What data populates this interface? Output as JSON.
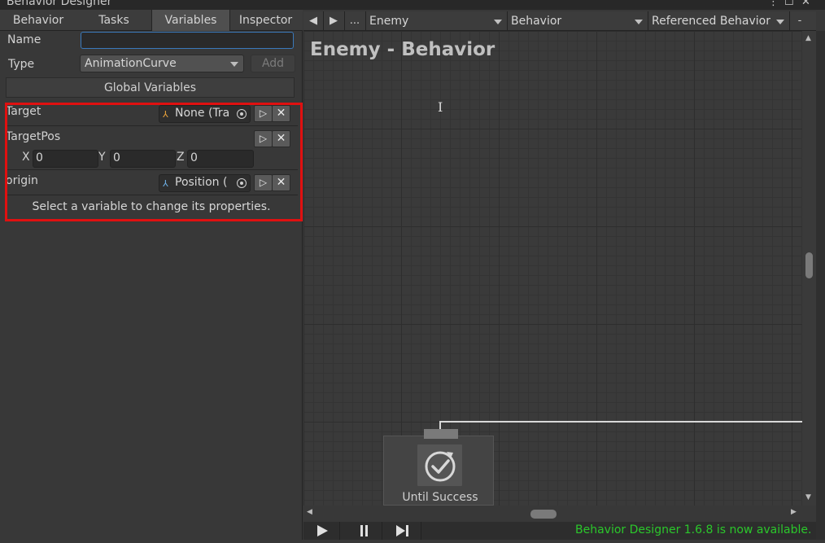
{
  "window": {
    "title": "Behavior Designer"
  },
  "left_tabs": [
    {
      "label": "Behavior"
    },
    {
      "label": "Tasks"
    },
    {
      "label": "Variables"
    },
    {
      "label": "Inspector"
    }
  ],
  "variables_panel": {
    "name_label": "Name",
    "name_value": "",
    "type_label": "Type",
    "type_value": "AnimationCurve",
    "add_label": "Add",
    "global_variables_label": "Global Variables",
    "variables": [
      {
        "name": "Target",
        "value": "None (Tra"
      },
      {
        "name": "TargetPos",
        "x_label": "X",
        "x": "0",
        "y_label": "Y",
        "y": "0",
        "z_label": "Z",
        "z": "0"
      },
      {
        "name": "origin",
        "value": "Position ("
      }
    ],
    "hint": "Select a variable to change its properties."
  },
  "toolbar": {
    "back_arrow": "◀",
    "forward_arrow": "▶",
    "more": "...",
    "object_dropdown": "Enemy",
    "behavior_dropdown": "Behavior",
    "referenced_dropdown": "Referenced Behavior",
    "minus": "-"
  },
  "graph": {
    "title": "Enemy - Behavior",
    "node_label": "Until Success"
  },
  "status": {
    "message": "Behavior Designer 1.6.8 is now available."
  },
  "colors": {
    "highlight_box": "#e01010",
    "status_text": "#2bc72b",
    "focus_border": "#3a79bb"
  },
  "icons": [
    "play-icon",
    "pause-icon",
    "step-icon",
    "object-picker-icon",
    "remove-icon",
    "until-success-icon"
  ]
}
